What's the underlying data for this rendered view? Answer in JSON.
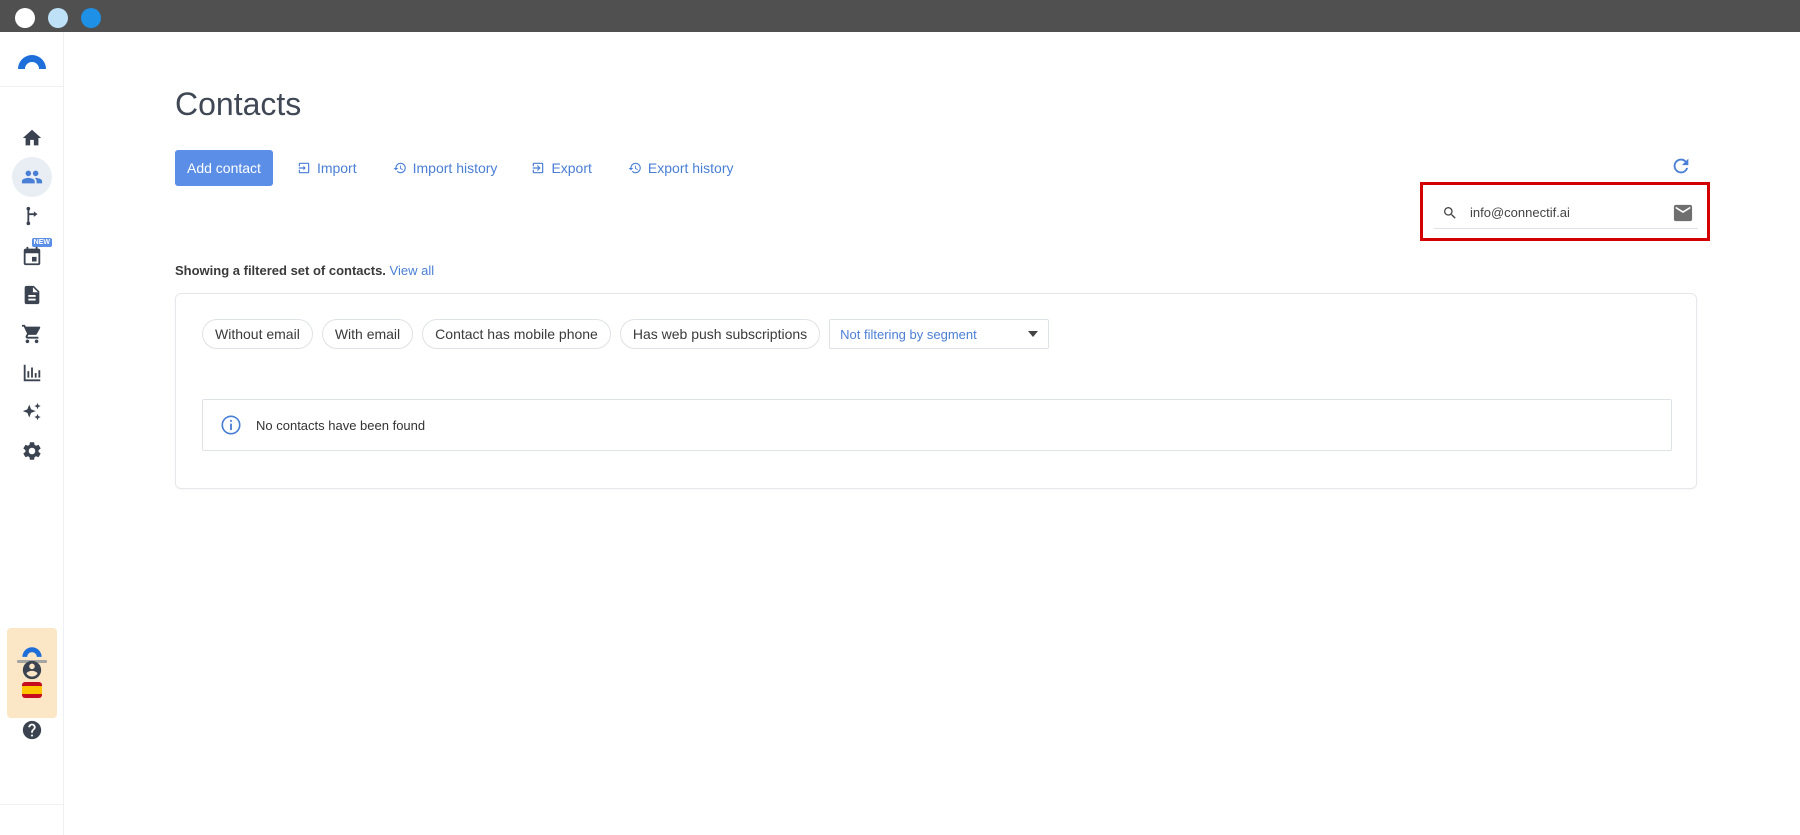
{
  "page": {
    "title": "Contacts"
  },
  "sidebar": {
    "items": [
      {
        "icon": "home-icon"
      },
      {
        "icon": "contacts-icon",
        "active": true
      },
      {
        "icon": "workflow-icon"
      },
      {
        "icon": "calendar-icon",
        "badge": "NEW"
      },
      {
        "icon": "document-icon"
      },
      {
        "icon": "cart-icon"
      },
      {
        "icon": "bar-chart-icon"
      },
      {
        "icon": "sparkles-icon"
      },
      {
        "icon": "gear-icon"
      }
    ],
    "bottom": [
      {
        "icon": "user-circle-icon"
      },
      {
        "icon": "help-icon"
      }
    ]
  },
  "toolbar": {
    "add_contact": "Add contact",
    "import": "Import",
    "import_history": "Import history",
    "export": "Export",
    "export_history": "Export history"
  },
  "search": {
    "value": "info@connectif.ai"
  },
  "filter_note": {
    "text": "Showing a filtered set of contacts.",
    "link": "View all"
  },
  "filters": {
    "chips": [
      "Without email",
      "With email",
      "Contact has mobile phone",
      "Has web push subscriptions"
    ],
    "segment_select": "Not filtering by segment"
  },
  "results": {
    "empty_message": "No contacts have been found"
  },
  "colors": {
    "accent": "#5b8ee6",
    "link": "#4a7fd6",
    "highlight": "#d40000",
    "titlebar": "#505050"
  }
}
